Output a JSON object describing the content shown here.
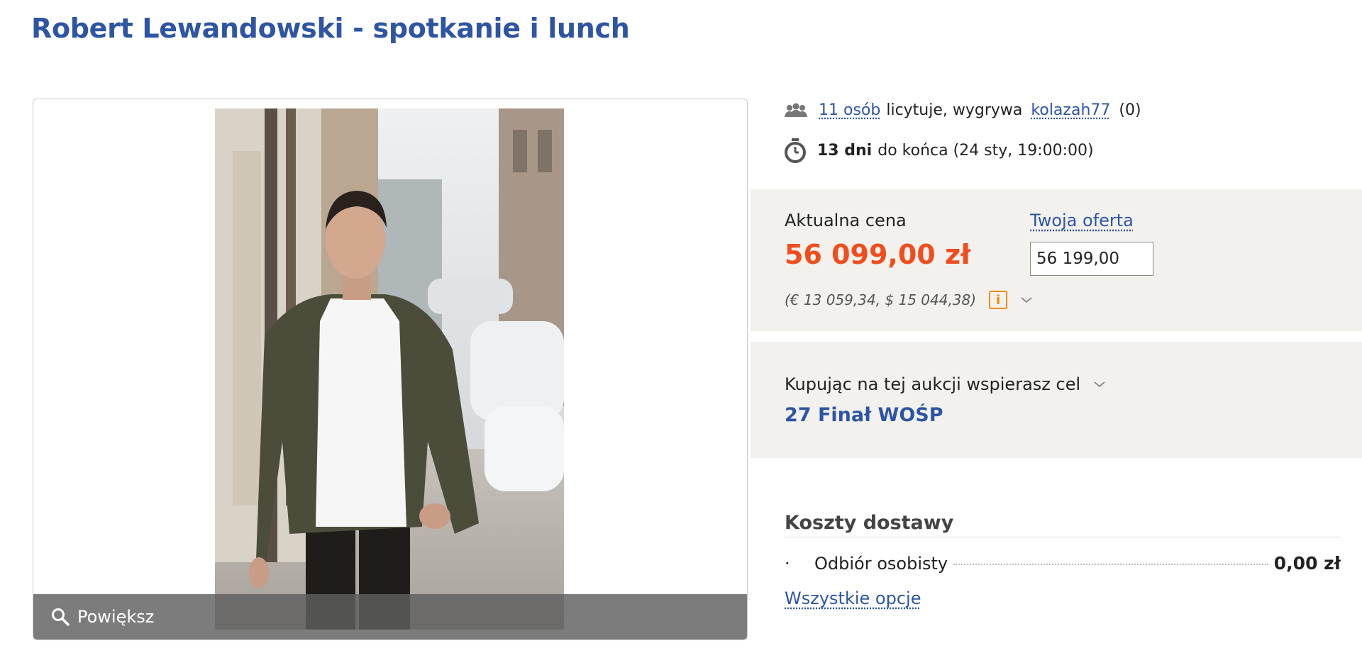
{
  "title": "Robert Lewandowski - spotkanie i lunch",
  "gallery": {
    "zoom_label": "Powiększ"
  },
  "auction": {
    "bidders_link": "11 osób",
    "bidders_text": "licytuje, wygrywa",
    "winner_link": "kolazah77",
    "winner_rating": "(0)",
    "time_bold": "13 dni",
    "time_text": "do końca (24 sty, 19:00:00)"
  },
  "price": {
    "label": "Aktualna cena",
    "value": "56 099,00 zł",
    "conversion": "(€ 13 059,34, $ 15 044,38)",
    "info_icon": "i",
    "offer_label": "Twoja oferta",
    "offer_value": "56 199,00"
  },
  "charity": {
    "label": "Kupując na tej aukcji wspierasz cel",
    "name": "27 Finał WOŚP"
  },
  "shipping": {
    "title": "Koszty dostawy",
    "bullet": "·",
    "option_name": "Odbiór osobisty",
    "option_price": "0,00 zł",
    "all_options": "Wszystkie opcje"
  },
  "colors": {
    "link": "#2e55a3",
    "price": "#ef4d1c",
    "panel_bg": "#f2f1ee",
    "info_orange": "#f08a00"
  }
}
